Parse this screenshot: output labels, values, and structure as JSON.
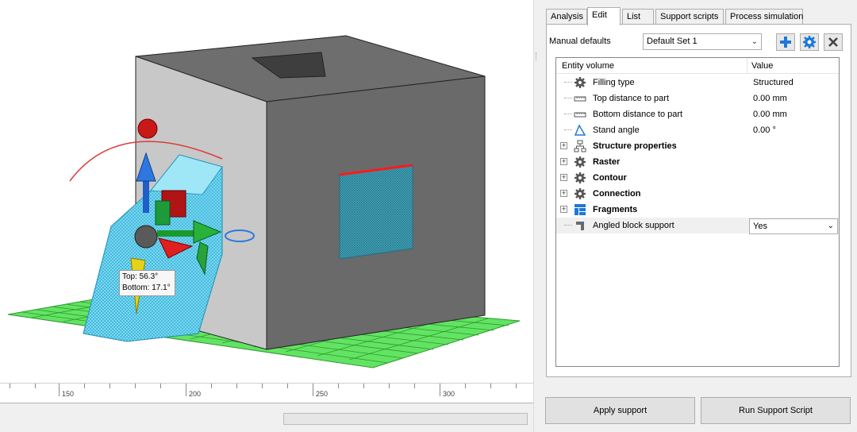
{
  "viewport": {
    "tooltip": {
      "top": "Top: 56.3°",
      "bottom": "Bottom: 17.1°"
    }
  },
  "ruler": {
    "labels": [
      "150",
      "200",
      "250",
      "300"
    ]
  },
  "tabs": [
    {
      "label": "Analysis",
      "active": false
    },
    {
      "label": "Edit",
      "active": true
    },
    {
      "label": "List",
      "active": false
    },
    {
      "label": "Support scripts",
      "active": false
    },
    {
      "label": "Process simulation",
      "active": false
    }
  ],
  "defaults": {
    "label": "Manual defaults",
    "selected": "Default Set 1",
    "add_icon": "plus-icon",
    "settings_icon": "gear-icon",
    "delete_icon": "close-icon"
  },
  "tree": {
    "col_name": "Entity volume",
    "col_value": "Value",
    "rows": [
      {
        "label": "Filling type",
        "value": "Structured",
        "icon": "gear-icon",
        "bold": false,
        "expandable": false
      },
      {
        "label": "Top distance to part",
        "value": "0.00 mm",
        "icon": "ruler-icon",
        "bold": false,
        "expandable": false
      },
      {
        "label": "Bottom distance to part",
        "value": "0.00 mm",
        "icon": "ruler-icon",
        "bold": false,
        "expandable": false
      },
      {
        "label": "Stand angle",
        "value": "0.00 °",
        "icon": "angle-icon",
        "bold": false,
        "expandable": false
      },
      {
        "label": "Structure properties",
        "value": "",
        "icon": "hierarchy-icon",
        "bold": true,
        "expandable": true
      },
      {
        "label": "Raster",
        "value": "",
        "icon": "gear-icon",
        "bold": true,
        "expandable": true
      },
      {
        "label": "Contour",
        "value": "",
        "icon": "gear-icon",
        "bold": true,
        "expandable": true
      },
      {
        "label": "Connection",
        "value": "",
        "icon": "gear-icon",
        "bold": true,
        "expandable": true
      },
      {
        "label": "Fragments",
        "value": "",
        "icon": "fragments-icon",
        "bold": true,
        "expandable": true
      },
      {
        "label": "Angled block support",
        "value": "Yes",
        "icon": "angled-block-icon",
        "bold": false,
        "expandable": false
      }
    ]
  },
  "buttons": {
    "apply": "Apply support",
    "run": "Run Support Script"
  },
  "colors": {
    "accent_blue": "#1e78d7",
    "support_cyan": "#5fd4f0",
    "platform_green": "#5fe05f"
  }
}
